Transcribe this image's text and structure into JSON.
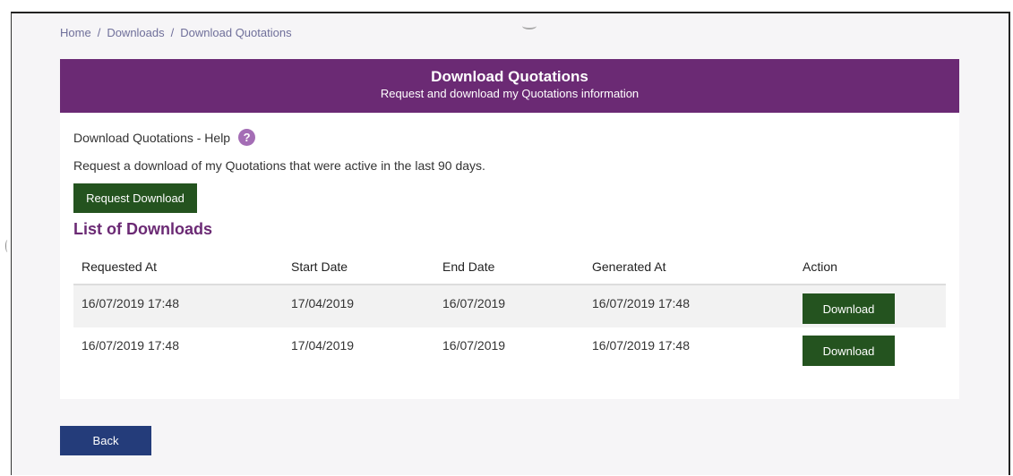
{
  "breadcrumb": {
    "items": [
      "Home",
      "Downloads",
      "Download Quotations"
    ],
    "separator": "/"
  },
  "panel": {
    "title": "Download Quotations",
    "subtitle": "Request and download my Quotations information",
    "help_label": "Download Quotations - Help",
    "help_icon": "question-mark-icon",
    "help_icon_glyph": "?",
    "description": "Request a download of my Quotations that were active in the last 90 days.",
    "request_button": "Request Download",
    "list_title": "List of Downloads"
  },
  "table": {
    "columns": [
      "Requested At",
      "Start Date",
      "End Date",
      "Generated At",
      "Action"
    ],
    "rows": [
      {
        "requested_at": "16/07/2019 17:48",
        "start_date": "17/04/2019",
        "end_date": "16/07/2019",
        "generated_at": "16/07/2019 17:48",
        "action": "Download"
      },
      {
        "requested_at": "16/07/2019 17:48",
        "start_date": "17/04/2019",
        "end_date": "16/07/2019",
        "generated_at": "16/07/2019 17:48",
        "action": "Download"
      }
    ]
  },
  "back_button": "Back",
  "colors": {
    "header_purple": "#6b2a74",
    "button_green": "#24531f",
    "back_blue": "#243c7a",
    "help_icon": "#a46db5"
  }
}
